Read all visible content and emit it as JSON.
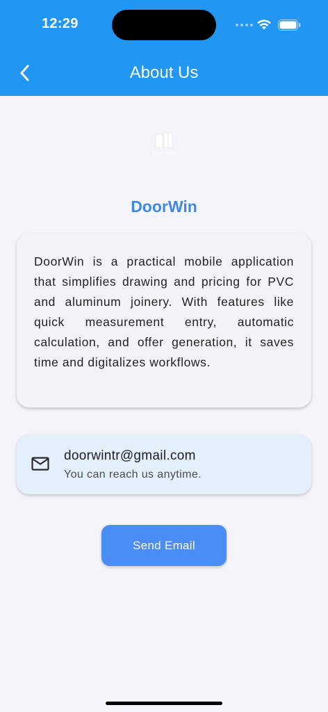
{
  "status_bar": {
    "time": "12:29",
    "icons": [
      "signal-dots-icon",
      "wifi-icon",
      "battery-icon"
    ]
  },
  "app_bar": {
    "title": "About Us",
    "back_icon": "chevron-left-icon",
    "background": "#2196f3"
  },
  "logo": {
    "icon": "door-logo-icon",
    "caption": "DoorWin"
  },
  "brand": {
    "name": "DoorWin",
    "color": "#3d8ae6"
  },
  "description": {
    "text": "DoorWin is a practical mobile application that simplifies drawing and pricing for PVC and aluminum joinery. With features like quick measurement entry, automatic calculation, and offer generation, it saves time and digitalizes workflows."
  },
  "contact": {
    "icon": "mail-icon",
    "email": "doorwintr@gmail.com",
    "subtitle": "You can reach us anytime."
  },
  "actions": {
    "send_email_label": "Send Email",
    "button_color": "#4a8df5"
  }
}
